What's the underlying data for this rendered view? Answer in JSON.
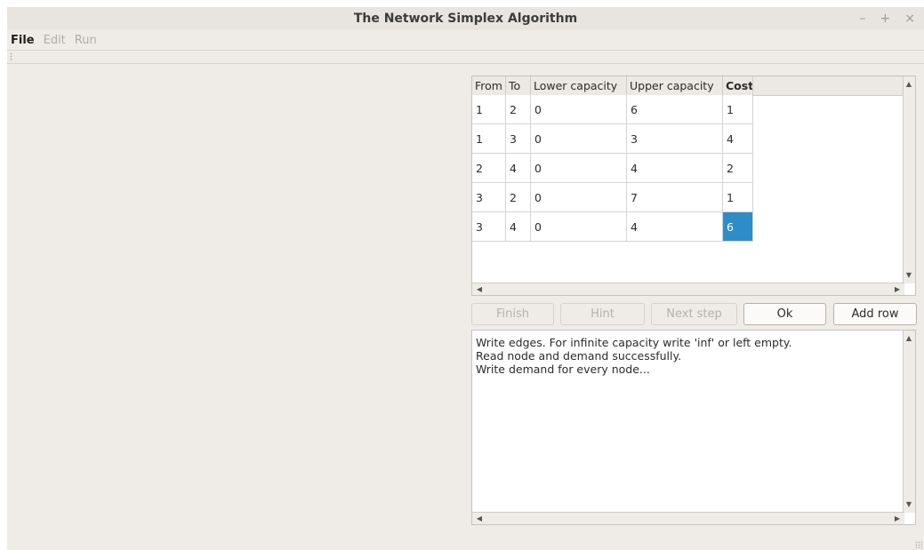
{
  "window": {
    "title": "The Network Simplex Algorithm",
    "controls": {
      "minimize": "–",
      "maximize": "+",
      "close": "×"
    }
  },
  "menu": {
    "items": [
      {
        "label": "File",
        "enabled": true
      },
      {
        "label": "Edit",
        "enabled": false
      },
      {
        "label": "Run",
        "enabled": false
      }
    ]
  },
  "table": {
    "headers": [
      "From",
      "To",
      "Lower capacity",
      "Upper capacity",
      "Cost"
    ],
    "rows": [
      [
        "1",
        "2",
        "0",
        "6",
        "1"
      ],
      [
        "1",
        "3",
        "0",
        "3",
        "4"
      ],
      [
        "2",
        "4",
        "0",
        "4",
        "2"
      ],
      [
        "3",
        "2",
        "0",
        "7",
        "1"
      ],
      [
        "3",
        "4",
        "0",
        "4",
        "6"
      ]
    ],
    "selected_cell": {
      "row": 4,
      "col": 4
    }
  },
  "buttons": {
    "finish": "Finish",
    "hint": "Hint",
    "next_step": "Next step",
    "ok": "Ok",
    "add_row": "Add row"
  },
  "log": {
    "lines": [
      "Write edges. For infinite capacity write 'inf' or left empty.",
      "Read node and demand successfully.",
      "Write demand for every node..."
    ]
  },
  "colors": {
    "window_bg": "#efebe7",
    "selection": "#308cc6"
  }
}
